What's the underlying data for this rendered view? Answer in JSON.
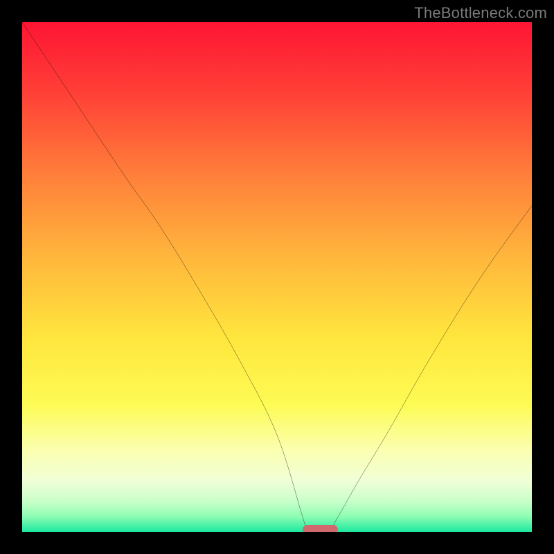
{
  "watermark": "TheBottleneck.com",
  "chart_data": {
    "type": "line",
    "title": "",
    "xlabel": "",
    "ylabel": "",
    "xlim": [
      0,
      100
    ],
    "ylim": [
      0,
      100
    ],
    "grid": false,
    "gradient_stops": [
      {
        "pct": 0,
        "color": "#fe1533"
      },
      {
        "pct": 14,
        "color": "#ff4037"
      },
      {
        "pct": 30,
        "color": "#ff7f3a"
      },
      {
        "pct": 46,
        "color": "#ffb63c"
      },
      {
        "pct": 62,
        "color": "#ffe63d"
      },
      {
        "pct": 75,
        "color": "#fdfb54"
      },
      {
        "pct": 84,
        "color": "#fbffb0"
      },
      {
        "pct": 90,
        "color": "#f0ffd7"
      },
      {
        "pct": 94,
        "color": "#c9ffc9"
      },
      {
        "pct": 97,
        "color": "#8dfdb3"
      },
      {
        "pct": 100,
        "color": "#1de9a0"
      }
    ],
    "series": [
      {
        "name": "bottleneck-curve",
        "x": [
          0,
          10,
          20,
          27,
          35,
          43,
          50,
          55,
          56,
          57,
          60,
          62,
          66,
          72,
          80,
          90,
          100
        ],
        "y": [
          100,
          85,
          70,
          60,
          47,
          33,
          19,
          3,
          0,
          0,
          0,
          3,
          10,
          20,
          34,
          50,
          64
        ]
      }
    ],
    "marker": {
      "x_start": 55,
      "x_end": 62,
      "y": 0,
      "color": "#d16a6f"
    }
  }
}
